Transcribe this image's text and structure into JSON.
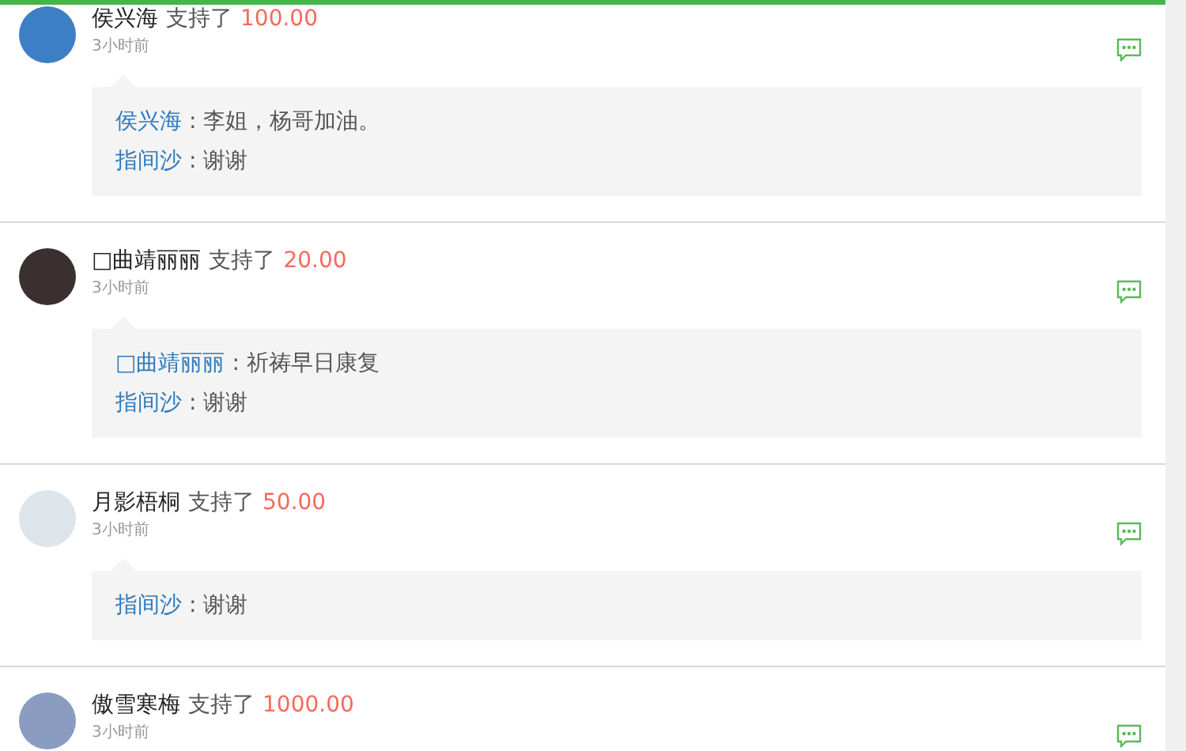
{
  "comments": [
    {
      "name": "侯兴海",
      "action": "支持了",
      "amount": "100.00",
      "time": "3小时前",
      "replies": [
        {
          "author": "侯兴海",
          "text": ": 李姐，杨哥加油。"
        },
        {
          "author": "指间沙",
          "text": ": 谢谢"
        }
      ]
    },
    {
      "name": "□曲靖丽丽",
      "action": "支持了",
      "amount": "20.00",
      "time": "3小时前",
      "replies": [
        {
          "author": "□曲靖丽丽",
          "text": ": 祈祷早日康复"
        },
        {
          "author": "指间沙",
          "text": ": 谢谢"
        }
      ]
    },
    {
      "name": "月影梧桐",
      "action": "支持了",
      "amount": "50.00",
      "time": "3小时前",
      "replies": [
        {
          "author": "指间沙",
          "text": ": 谢谢"
        }
      ]
    },
    {
      "name": "傲雪寒梅",
      "action": "支持了",
      "amount": "1000.00",
      "time": "3小时前"
    }
  ]
}
